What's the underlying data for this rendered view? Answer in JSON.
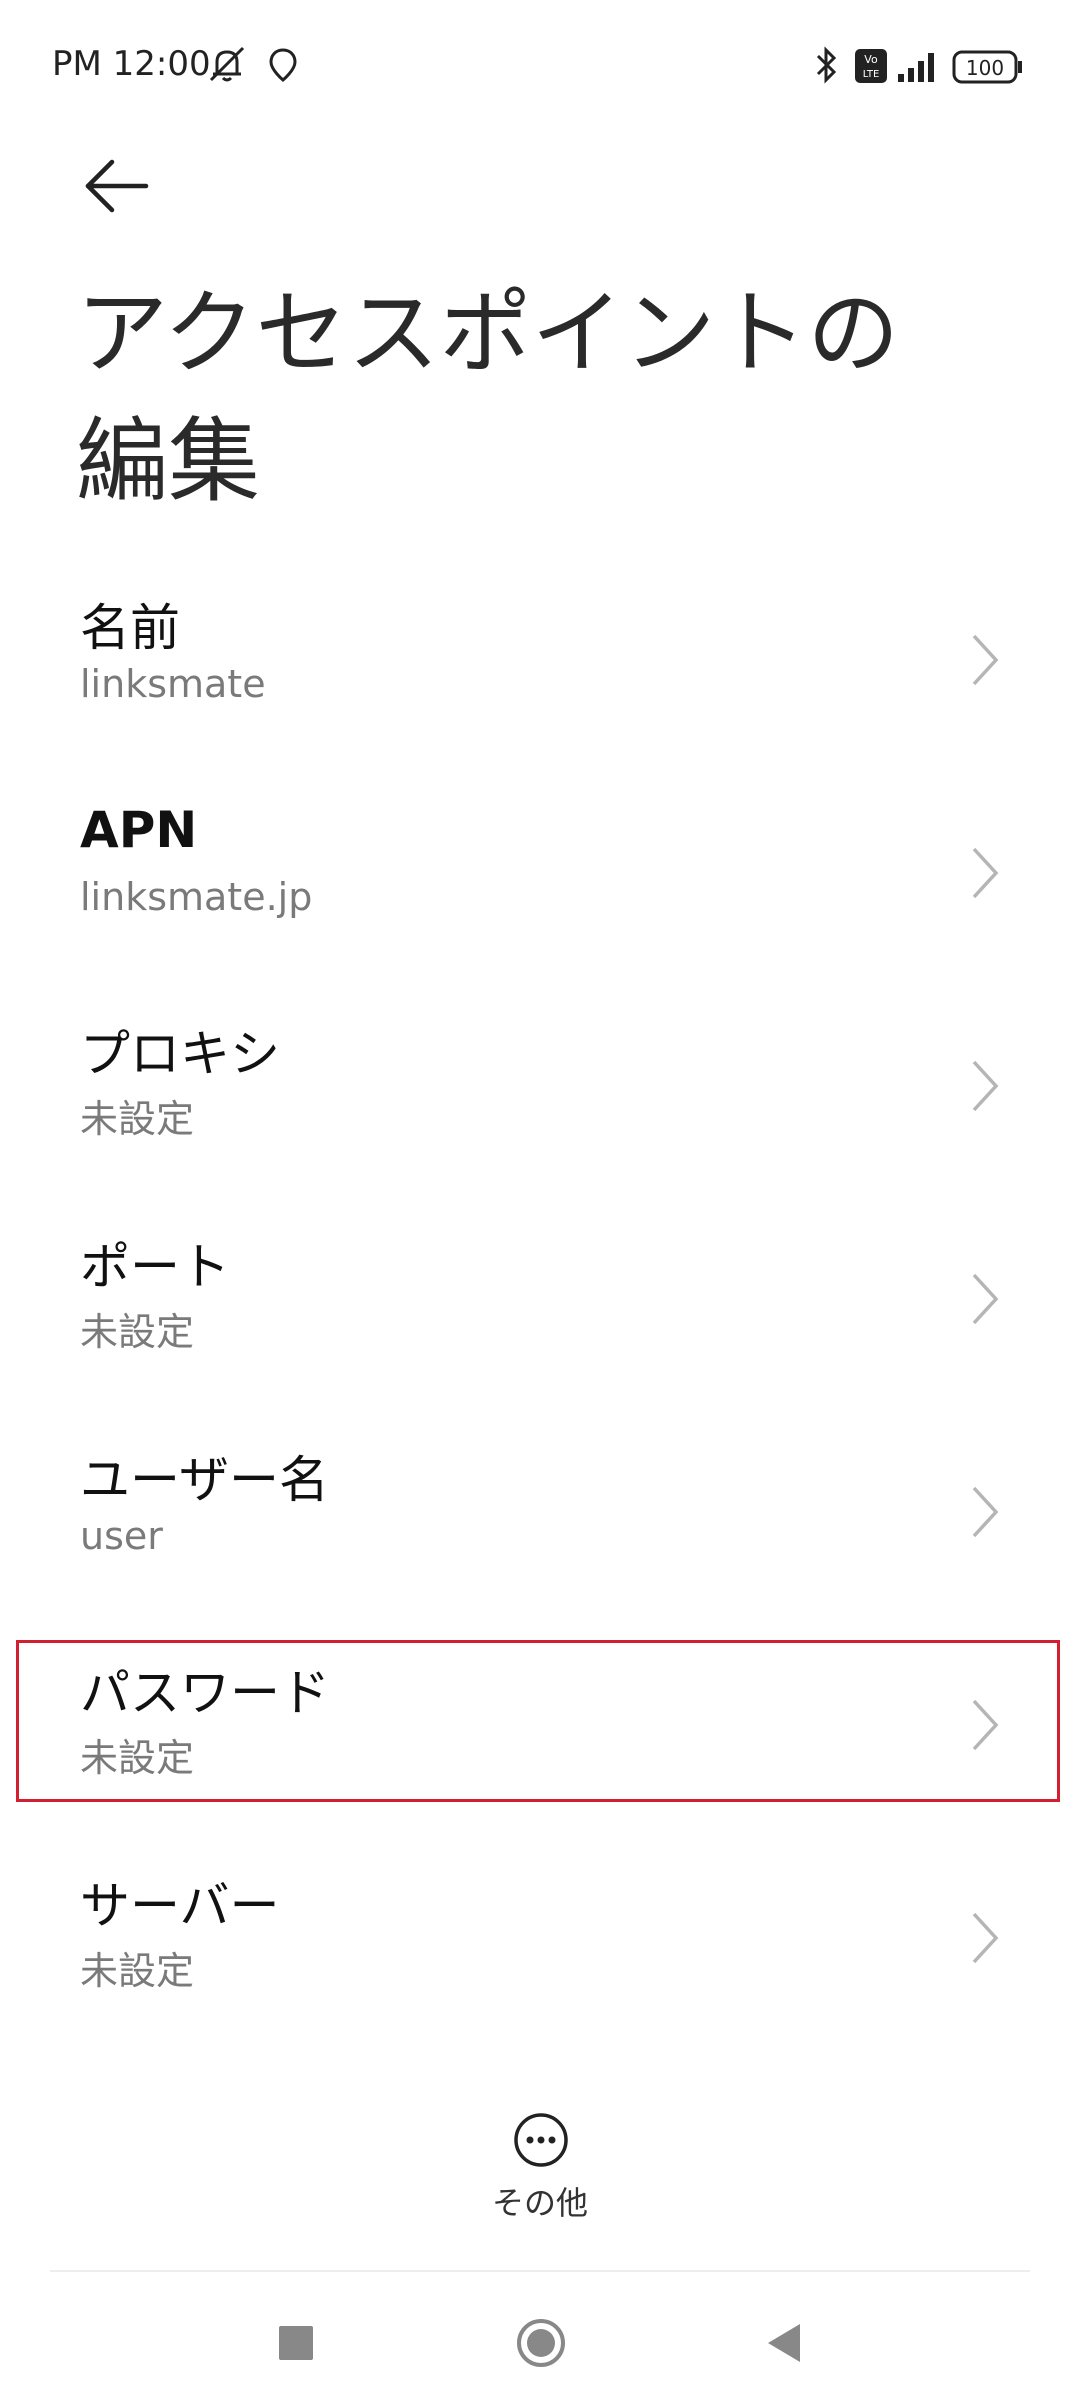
{
  "status_bar": {
    "time": "PM 12:00",
    "icons": [
      "muted-bell-icon",
      "location-icon",
      "bluetooth-icon",
      "volte-icon",
      "signal-icon",
      "battery-icon"
    ],
    "volte_top": "Vo",
    "volte_bottom": "LTE",
    "battery": "100"
  },
  "header": {
    "back_icon": "back-arrow-icon",
    "title": "アクセスポイントの編集"
  },
  "settings": [
    {
      "label": "名前",
      "value": "linksmate"
    },
    {
      "label": "APN",
      "value": "linksmate.jp"
    },
    {
      "label": "プロキシ",
      "value": "未設定"
    },
    {
      "label": "ポート",
      "value": "未設定"
    },
    {
      "label": "ユーザー名",
      "value": "user"
    },
    {
      "label": "パスワード",
      "value": "未設定"
    },
    {
      "label": "サーバー",
      "value": "未設定"
    }
  ],
  "highlighted_item": "パスワード",
  "highlight_color": "#d32030",
  "more": {
    "icon": "more-icon",
    "label": "その他"
  },
  "navigation": [
    "recent-apps-icon",
    "home-icon",
    "back-icon"
  ]
}
